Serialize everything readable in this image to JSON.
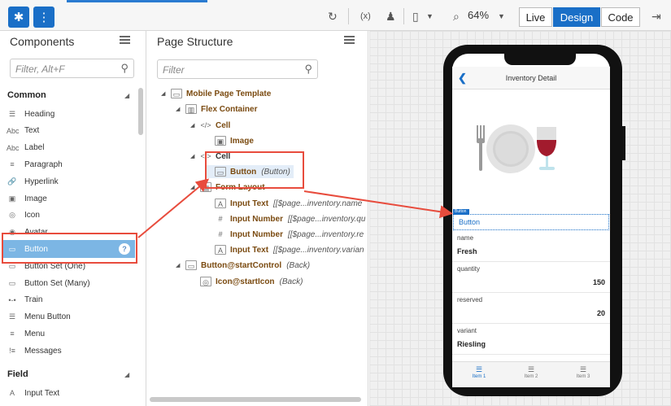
{
  "toolbar": {
    "zoom": "64%",
    "modes": [
      "Live",
      "Design",
      "Code"
    ],
    "active_mode": "Design",
    "colors": {
      "accent": "#1a6fc7",
      "highlight": "#e84c3d"
    }
  },
  "components": {
    "title": "Components",
    "search_placeholder": "Filter, Alt+F",
    "common_title": "Common",
    "common": [
      {
        "icon": "heading-icon",
        "glyph": "☰",
        "label": "Heading"
      },
      {
        "icon": "text-icon",
        "glyph": "Abc",
        "label": "Text"
      },
      {
        "icon": "label-icon",
        "glyph": "Abc",
        "label": "Label"
      },
      {
        "icon": "paragraph-icon",
        "glyph": "≡",
        "label": "Paragraph"
      },
      {
        "icon": "hyperlink-icon",
        "glyph": "🔗",
        "label": "Hyperlink"
      },
      {
        "icon": "image-icon",
        "glyph": "▣",
        "label": "Image"
      },
      {
        "icon": "icon-icon",
        "glyph": "◎",
        "label": "Icon"
      },
      {
        "icon": "avatar-icon",
        "glyph": "◉",
        "label": "Avatar"
      },
      {
        "icon": "button-icon",
        "glyph": "▭",
        "label": "Button",
        "help": "?"
      },
      {
        "icon": "button-set-one-icon",
        "glyph": "▭",
        "label": "Button Set (One)"
      },
      {
        "icon": "button-set-many-icon",
        "glyph": "▭",
        "label": "Button Set (Many)"
      },
      {
        "icon": "train-icon",
        "glyph": "•-•",
        "label": "Train"
      },
      {
        "icon": "menu-button-icon",
        "glyph": "☰",
        "label": "Menu Button"
      },
      {
        "icon": "menu-icon",
        "glyph": "≡",
        "label": "Menu"
      },
      {
        "icon": "messages-icon",
        "glyph": "!≡",
        "label": "Messages"
      }
    ],
    "field_title": "Field",
    "field": [
      {
        "icon": "input-text-icon",
        "glyph": "A",
        "label": "Input Text"
      }
    ]
  },
  "structure": {
    "title": "Page Structure",
    "search_placeholder": "Filter",
    "nodes": [
      {
        "label": "Mobile Page Template",
        "type": "",
        "icon": "page-icon",
        "glyph": "▭"
      },
      {
        "label": "Flex Container",
        "type": "",
        "icon": "flex-container-icon",
        "glyph": "▥"
      },
      {
        "label": "Cell",
        "type": "",
        "icon": "code-icon",
        "glyph": "</>"
      },
      {
        "label": "Image",
        "type": "",
        "icon": "image-icon",
        "glyph": "▣"
      },
      {
        "label": "Cell",
        "type": "",
        "icon": "code-icon",
        "glyph": "</>"
      },
      {
        "label": "Button",
        "type": "(Button)",
        "icon": "button-icon",
        "glyph": "▭"
      },
      {
        "label": "Form Layout",
        "type": "",
        "icon": "form-layout-icon",
        "glyph": "▤"
      },
      {
        "label": "Input Text",
        "type": "[[$page...inventory.name",
        "icon": "input-text-icon",
        "glyph": "A"
      },
      {
        "label": "Input Number",
        "type": "[[$page...inventory.qu",
        "icon": "input-number-icon",
        "glyph": "#"
      },
      {
        "label": "Input Number",
        "type": "[[$page...inventory.re",
        "icon": "input-number-icon",
        "glyph": "#"
      },
      {
        "label": "Input Text",
        "type": "[[$page...inventory.varian",
        "icon": "input-text-icon",
        "glyph": "A"
      },
      {
        "label": "Button@startControl",
        "type": "(Back)",
        "icon": "button-icon",
        "glyph": "▭"
      },
      {
        "label": "Icon@startIcon",
        "type": "(Back)",
        "icon": "icon-icon",
        "glyph": "◎"
      }
    ]
  },
  "preview": {
    "page_title": "Inventory Detail",
    "button_tag": "Button",
    "button_label": "Button",
    "fields": [
      {
        "label": "name",
        "value": "Fresh"
      },
      {
        "label": "quantity",
        "value": "150"
      },
      {
        "label": "reserved",
        "value": "20"
      },
      {
        "label": "variant",
        "value": "Riesling"
      }
    ],
    "tabs": [
      "Item 1",
      "Item 2",
      "Item 3"
    ]
  }
}
